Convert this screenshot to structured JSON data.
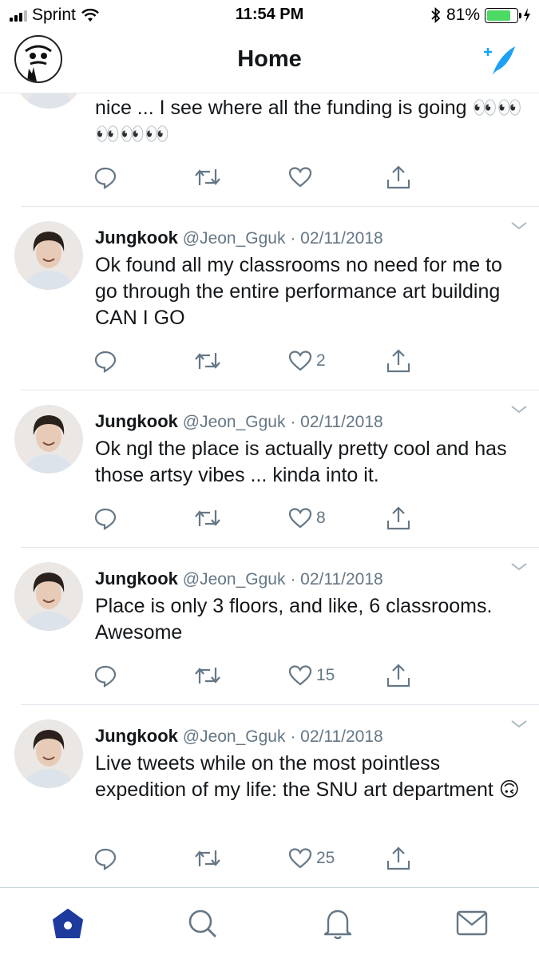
{
  "status_bar": {
    "carrier": "Sprint",
    "time": "11:54 PM",
    "battery_percent": "81%",
    "battery_level": 0.81,
    "battery_color": "#4cd964"
  },
  "header": {
    "title": "Home",
    "compose_icon": "compose-quill-icon",
    "accent_color": "#1da1f2"
  },
  "partial_tweet": {
    "body": "nice ... I see where all the funding is going 👀👀👀👀👀"
  },
  "tweets": [
    {
      "name": "Jungkook",
      "handle": "@Jeon_Gguk",
      "date": "· 02/11/2018",
      "body": "Ok found all my classrooms no need for me to go through the entire performance art building CAN I GO",
      "likes": "2"
    },
    {
      "name": "Jungkook",
      "handle": "@Jeon_Gguk",
      "date": "· 02/11/2018",
      "body": "Ok ngl the place is actually pretty cool and has those artsy vibes ... kinda into it.",
      "likes": "8"
    },
    {
      "name": "Jungkook",
      "handle": "@Jeon_Gguk",
      "date": "· 02/11/2018",
      "body": "Place is only 3 floors, and like, 6 classrooms. Awesome",
      "likes": "15"
    },
    {
      "name": "Jungkook",
      "handle": "@Jeon_Gguk",
      "date": "· 02/11/2018",
      "body": "Live tweets while on the most pointless expedition of my life: the SNU art department 🙃",
      "likes": "25"
    }
  ],
  "tabbar": {
    "items": [
      "home-icon",
      "search-icon",
      "notifications-bell-icon",
      "messages-envelope-icon"
    ],
    "active_color": "#1d3a9c"
  }
}
